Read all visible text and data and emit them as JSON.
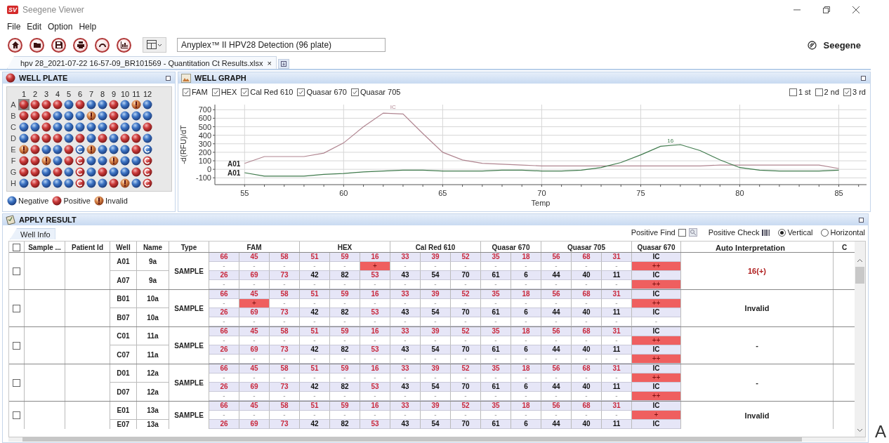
{
  "window": {
    "logo": "SV",
    "title": "Seegene Viewer",
    "controls": [
      {
        "kind": "minimize"
      },
      {
        "kind": "restore"
      },
      {
        "kind": "close"
      }
    ]
  },
  "menu": [
    "File",
    "Edit",
    "Option",
    "Help"
  ],
  "toolbar": {
    "buttons": [
      {
        "kind": "home"
      },
      {
        "kind": "open"
      },
      {
        "kind": "save"
      },
      {
        "kind": "print"
      },
      {
        "kind": "arch"
      },
      {
        "kind": "chart"
      }
    ],
    "layout_button": {
      "kind": "layout"
    },
    "assay": "Anyplex™ II HPV28 Detection (96 plate)",
    "brand": "Seegene"
  },
  "document_tabs": [
    {
      "label": "hpv 28_2021-07-22 16-57-09_BR101569 -  Quantitation Ct Results.xlsx",
      "close": "×",
      "selected": true
    }
  ],
  "well_plate": {
    "title": "WELL PLATE",
    "columns": [
      "1",
      "2",
      "3",
      "4",
      "5",
      "6",
      "7",
      "8",
      "9",
      "10",
      "11",
      "12"
    ],
    "rows": [
      {
        "label": "A",
        "wells": [
          {
            "kind": "positive",
            "selected": true
          },
          {
            "kind": "positive",
            "selected": false
          },
          {
            "kind": "positive",
            "selected": false
          },
          {
            "kind": "positive",
            "selected": false
          },
          {
            "kind": "negative",
            "selected": false
          },
          {
            "kind": "positive",
            "selected": false
          },
          {
            "kind": "negative",
            "selected": false
          },
          {
            "kind": "negative",
            "selected": false
          },
          {
            "kind": "positive",
            "selected": false
          },
          {
            "kind": "negative",
            "selected": false
          },
          {
            "kind": "invalid",
            "selected": false
          },
          {
            "kind": "negative",
            "selected": false
          }
        ]
      },
      {
        "label": "B",
        "wells": [
          {
            "kind": "positive",
            "selected": false
          },
          {
            "kind": "positive",
            "selected": false
          },
          {
            "kind": "positive",
            "selected": false
          },
          {
            "kind": "negative",
            "selected": false
          },
          {
            "kind": "negative",
            "selected": false
          },
          {
            "kind": "negative",
            "selected": false
          },
          {
            "kind": "invalid",
            "selected": false
          },
          {
            "kind": "negative",
            "selected": false
          },
          {
            "kind": "positive",
            "selected": false
          },
          {
            "kind": "negative",
            "selected": false
          },
          {
            "kind": "negative",
            "selected": false
          },
          {
            "kind": "negative",
            "selected": false
          }
        ]
      },
      {
        "label": "C",
        "wells": [
          {
            "kind": "negative",
            "selected": false
          },
          {
            "kind": "negative",
            "selected": false
          },
          {
            "kind": "positive",
            "selected": false
          },
          {
            "kind": "negative",
            "selected": false
          },
          {
            "kind": "negative",
            "selected": false
          },
          {
            "kind": "negative",
            "selected": false
          },
          {
            "kind": "negative",
            "selected": false
          },
          {
            "kind": "negative",
            "selected": false
          },
          {
            "kind": "positive",
            "selected": false
          },
          {
            "kind": "negative",
            "selected": false
          },
          {
            "kind": "negative",
            "selected": false
          },
          {
            "kind": "positive",
            "selected": false
          }
        ]
      },
      {
        "label": "D",
        "wells": [
          {
            "kind": "negative",
            "selected": false
          },
          {
            "kind": "positive",
            "selected": false
          },
          {
            "kind": "positive",
            "selected": false
          },
          {
            "kind": "positive",
            "selected": false
          },
          {
            "kind": "negative",
            "selected": false
          },
          {
            "kind": "positive",
            "selected": false
          },
          {
            "kind": "negative",
            "selected": false
          },
          {
            "kind": "positive",
            "selected": false
          },
          {
            "kind": "negative",
            "selected": false
          },
          {
            "kind": "positive",
            "selected": false
          },
          {
            "kind": "positive",
            "selected": false
          },
          {
            "kind": "negative",
            "selected": false
          }
        ]
      },
      {
        "label": "E",
        "wells": [
          {
            "kind": "invalid",
            "selected": false
          },
          {
            "kind": "positive",
            "selected": false
          },
          {
            "kind": "negative",
            "selected": false
          },
          {
            "kind": "negative",
            "selected": false
          },
          {
            "kind": "positive",
            "selected": false
          },
          {
            "kind": "control_negative",
            "selected": false
          },
          {
            "kind": "invalid",
            "selected": false
          },
          {
            "kind": "negative",
            "selected": false
          },
          {
            "kind": "negative",
            "selected": false
          },
          {
            "kind": "negative",
            "selected": false
          },
          {
            "kind": "positive",
            "selected": false
          },
          {
            "kind": "control_negative",
            "selected": false
          }
        ]
      },
      {
        "label": "F",
        "wells": [
          {
            "kind": "positive",
            "selected": false
          },
          {
            "kind": "positive",
            "selected": false
          },
          {
            "kind": "invalid",
            "selected": false
          },
          {
            "kind": "negative",
            "selected": false
          },
          {
            "kind": "positive",
            "selected": false
          },
          {
            "kind": "control_positive",
            "selected": false
          },
          {
            "kind": "negative",
            "selected": false
          },
          {
            "kind": "negative",
            "selected": false
          },
          {
            "kind": "invalid",
            "selected": false
          },
          {
            "kind": "negative",
            "selected": false
          },
          {
            "kind": "negative",
            "selected": false
          },
          {
            "kind": "control_positive",
            "selected": false
          }
        ]
      },
      {
        "label": "G",
        "wells": [
          {
            "kind": "positive",
            "selected": false
          },
          {
            "kind": "positive",
            "selected": false
          },
          {
            "kind": "negative",
            "selected": false
          },
          {
            "kind": "positive",
            "selected": false
          },
          {
            "kind": "negative",
            "selected": false
          },
          {
            "kind": "control_positive",
            "selected": false
          },
          {
            "kind": "negative",
            "selected": false
          },
          {
            "kind": "positive",
            "selected": false
          },
          {
            "kind": "negative",
            "selected": false
          },
          {
            "kind": "negative",
            "selected": false
          },
          {
            "kind": "positive",
            "selected": false
          },
          {
            "kind": "control_positive",
            "selected": false
          }
        ]
      },
      {
        "label": "H",
        "wells": [
          {
            "kind": "negative",
            "selected": false
          },
          {
            "kind": "positive",
            "selected": false
          },
          {
            "kind": "negative",
            "selected": false
          },
          {
            "kind": "negative",
            "selected": false
          },
          {
            "kind": "negative",
            "selected": false
          },
          {
            "kind": "control_positive",
            "selected": false
          },
          {
            "kind": "negative",
            "selected": false
          },
          {
            "kind": "negative",
            "selected": false
          },
          {
            "kind": "positive",
            "selected": false
          },
          {
            "kind": "invalid",
            "selected": false
          },
          {
            "kind": "negative",
            "selected": false
          },
          {
            "kind": "control_positive",
            "selected": false
          }
        ]
      }
    ],
    "legend": [
      {
        "kind": "negative",
        "label": "Negative"
      },
      {
        "kind": "positive",
        "label": "Positive"
      },
      {
        "kind": "invalid",
        "label": "Invalid"
      }
    ]
  },
  "well_graph": {
    "title": "WELL GRAPH",
    "channels": [
      {
        "label": "FAM",
        "checked": true
      },
      {
        "label": "HEX",
        "checked": true
      },
      {
        "label": "Cal Red 610",
        "checked": true
      },
      {
        "label": "Quasar 670",
        "checked": true
      },
      {
        "label": "Quasar 705",
        "checked": true
      }
    ],
    "melts": [
      {
        "label": "1 st",
        "checked": false
      },
      {
        "label": "2 nd",
        "checked": false
      },
      {
        "label": "3 rd",
        "checked": true
      }
    ],
    "chart_data": {
      "type": "line",
      "xlabel": "Temp",
      "ylabel": "-d(RFU)/dT",
      "x": [
        55,
        56,
        57,
        58,
        59,
        60,
        61,
        62,
        63,
        64,
        65,
        66,
        67,
        68,
        69,
        70,
        71,
        72,
        73,
        74,
        75,
        76,
        77,
        78,
        79,
        80,
        81,
        82,
        83,
        84,
        85
      ],
      "series": [
        {
          "name": "A01",
          "color": "#b08590",
          "values": [
            70,
            150,
            150,
            150,
            190,
            310,
            500,
            660,
            650,
            420,
            200,
            110,
            70,
            60,
            50,
            40,
            40,
            40,
            40,
            40,
            40,
            40,
            40,
            40,
            50,
            50,
            50,
            50,
            50,
            50,
            10
          ]
        },
        {
          "name": "A01",
          "color": "#3f7a4c",
          "values": [
            -40,
            -80,
            -80,
            -80,
            -60,
            -50,
            -30,
            -20,
            -10,
            -10,
            -20,
            -20,
            -20,
            -10,
            -10,
            -20,
            -20,
            -10,
            20,
            80,
            170,
            270,
            290,
            220,
            110,
            20,
            -10,
            -20,
            -20,
            -20,
            -10
          ]
        }
      ],
      "xlim": [
        53.5,
        86.4
      ],
      "ylim": [
        -180,
        760
      ],
      "xticks": [
        55,
        60,
        65,
        70,
        75,
        80,
        85
      ],
      "yticks": [
        -100,
        0,
        100,
        200,
        300,
        400,
        500,
        600,
        700
      ],
      "grid": true,
      "annotations": [
        {
          "x": 62.5,
          "y": 690,
          "text": "IC"
        },
        {
          "x": 76.5,
          "y": 300,
          "text": "16"
        }
      ]
    }
  },
  "apply_result": {
    "title": "APPLY RESULT",
    "tabs": [
      {
        "label": "Well Info",
        "selected": true
      }
    ],
    "positive_find": {
      "label": "Positive Find",
      "checked": false
    },
    "positive_check": {
      "label": "Positive Check"
    },
    "orientation": [
      {
        "label": "Vertical",
        "selected": true
      },
      {
        "label": "Horizontal",
        "selected": false
      }
    ],
    "columns": {
      "check_all": false,
      "sample": "Sample ...",
      "patient": "Patient Id",
      "well": "Well",
      "name": "Name",
      "type": "Type",
      "channels": [
        "FAM",
        "HEX",
        "Cal Red 610",
        "Quasar 670",
        "Quasar 705",
        "Quasar 670"
      ],
      "interpretation": "Auto  Interpretation",
      "column_14": "C"
    },
    "groups": [
      {
        "checked": false,
        "type": "SAMPLE",
        "interpretation": "16(+)",
        "interpretation_positive": true,
        "wells": [
          {
            "well": "A01",
            "name": "9a",
            "types": [
              [
                "66",
                "45",
                "58"
              ],
              [
                "51",
                "59",
                "16"
              ],
              [
                "33",
                "39",
                "52"
              ],
              [
                "35",
                "18"
              ],
              [
                "56",
                "68",
                "31"
              ],
              [
                "IC"
              ]
            ],
            "high_risk": [
              [
                true,
                true,
                true
              ],
              [
                true,
                true,
                true
              ],
              [
                true,
                true,
                true
              ],
              [
                true,
                true
              ],
              [
                true,
                true,
                true
              ],
              [
                false
              ]
            ],
            "results": [
              [
                "-",
                "-",
                "-"
              ],
              [
                "-",
                "-",
                "+"
              ],
              [
                "-",
                "-",
                "-"
              ],
              [
                "-",
                "-"
              ],
              [
                "-",
                "-",
                "-"
              ],
              [
                "++"
              ]
            ],
            "hits": [
              [
                false,
                false,
                false
              ],
              [
                false,
                false,
                true
              ],
              [
                false,
                false,
                false
              ],
              [
                false,
                false
              ],
              [
                false,
                false,
                false
              ],
              [
                true
              ]
            ]
          },
          {
            "well": "A07",
            "name": "9a",
            "types": [
              [
                "26",
                "69",
                "73"
              ],
              [
                "42",
                "82",
                "53"
              ],
              [
                "43",
                "54",
                "70"
              ],
              [
                "61",
                "6"
              ],
              [
                "44",
                "40",
                "11"
              ],
              [
                "IC"
              ]
            ],
            "high_risk": [
              [
                true,
                true,
                true
              ],
              [
                false,
                false,
                true
              ],
              [
                false,
                false,
                false
              ],
              [
                false,
                false
              ],
              [
                false,
                false,
                false
              ],
              [
                false
              ]
            ],
            "results": [
              [
                "-",
                "-",
                "-"
              ],
              [
                "-",
                "-",
                "-"
              ],
              [
                "-",
                "-",
                "-"
              ],
              [
                "-",
                "-"
              ],
              [
                "-",
                "-",
                "-"
              ],
              [
                "++"
              ]
            ],
            "hits": [
              [
                false,
                false,
                false
              ],
              [
                false,
                false,
                false
              ],
              [
                false,
                false,
                false
              ],
              [
                false,
                false
              ],
              [
                false,
                false,
                false
              ],
              [
                true
              ]
            ]
          }
        ]
      },
      {
        "checked": false,
        "type": "SAMPLE",
        "interpretation": "Invalid",
        "interpretation_positive": false,
        "wells": [
          {
            "well": "B01",
            "name": "10a",
            "types": [
              [
                "66",
                "45",
                "58"
              ],
              [
                "51",
                "59",
                "16"
              ],
              [
                "33",
                "39",
                "52"
              ],
              [
                "35",
                "18"
              ],
              [
                "56",
                "68",
                "31"
              ],
              [
                "IC"
              ]
            ],
            "high_risk": [
              [
                true,
                true,
                true
              ],
              [
                true,
                true,
                true
              ],
              [
                true,
                true,
                true
              ],
              [
                true,
                true
              ],
              [
                true,
                true,
                true
              ],
              [
                false
              ]
            ],
            "results": [
              [
                "-",
                "+",
                "-"
              ],
              [
                "-",
                "-",
                "-"
              ],
              [
                "-",
                "-",
                "-"
              ],
              [
                "-",
                "-"
              ],
              [
                "-",
                "-",
                "-"
              ],
              [
                "++"
              ]
            ],
            "hits": [
              [
                false,
                true,
                false
              ],
              [
                false,
                false,
                false
              ],
              [
                false,
                false,
                false
              ],
              [
                false,
                false
              ],
              [
                false,
                false,
                false
              ],
              [
                true
              ]
            ]
          },
          {
            "well": "B07",
            "name": "10a",
            "types": [
              [
                "26",
                "69",
                "73"
              ],
              [
                "42",
                "82",
                "53"
              ],
              [
                "43",
                "54",
                "70"
              ],
              [
                "61",
                "6"
              ],
              [
                "44",
                "40",
                "11"
              ],
              [
                "IC"
              ]
            ],
            "high_risk": [
              [
                true,
                true,
                true
              ],
              [
                false,
                false,
                true
              ],
              [
                false,
                false,
                false
              ],
              [
                false,
                false
              ],
              [
                false,
                false,
                false
              ],
              [
                false
              ]
            ],
            "results": [
              [
                "-",
                "-",
                "-"
              ],
              [
                "-",
                "-",
                "-"
              ],
              [
                "-",
                "-",
                "-"
              ],
              [
                "-",
                "-"
              ],
              [
                "-",
                "-",
                "-"
              ],
              [
                "-"
              ]
            ],
            "hits": [
              [
                false,
                false,
                false
              ],
              [
                false,
                false,
                false
              ],
              [
                false,
                false,
                false
              ],
              [
                false,
                false
              ],
              [
                false,
                false,
                false
              ],
              [
                false
              ]
            ]
          }
        ]
      },
      {
        "checked": false,
        "type": "SAMPLE",
        "interpretation": "-",
        "interpretation_positive": false,
        "wells": [
          {
            "well": "C01",
            "name": "11a",
            "types": [
              [
                "66",
                "45",
                "58"
              ],
              [
                "51",
                "59",
                "16"
              ],
              [
                "33",
                "39",
                "52"
              ],
              [
                "35",
                "18"
              ],
              [
                "56",
                "68",
                "31"
              ],
              [
                "IC"
              ]
            ],
            "high_risk": [
              [
                true,
                true,
                true
              ],
              [
                true,
                true,
                true
              ],
              [
                true,
                true,
                true
              ],
              [
                true,
                true
              ],
              [
                true,
                true,
                true
              ],
              [
                false
              ]
            ],
            "results": [
              [
                "-",
                "-",
                "-"
              ],
              [
                "-",
                "-",
                "-"
              ],
              [
                "-",
                "-",
                "-"
              ],
              [
                "-",
                "-"
              ],
              [
                "-",
                "-",
                "-"
              ],
              [
                "++"
              ]
            ],
            "hits": [
              [
                false,
                false,
                false
              ],
              [
                false,
                false,
                false
              ],
              [
                false,
                false,
                false
              ],
              [
                false,
                false
              ],
              [
                false,
                false,
                false
              ],
              [
                true
              ]
            ]
          },
          {
            "well": "C07",
            "name": "11a",
            "types": [
              [
                "26",
                "69",
                "73"
              ],
              [
                "42",
                "82",
                "53"
              ],
              [
                "43",
                "54",
                "70"
              ],
              [
                "61",
                "6"
              ],
              [
                "44",
                "40",
                "11"
              ],
              [
                "IC"
              ]
            ],
            "high_risk": [
              [
                true,
                true,
                true
              ],
              [
                false,
                false,
                true
              ],
              [
                false,
                false,
                false
              ],
              [
                false,
                false
              ],
              [
                false,
                false,
                false
              ],
              [
                false
              ]
            ],
            "results": [
              [
                "-",
                "-",
                "-"
              ],
              [
                "-",
                "-",
                "-"
              ],
              [
                "-",
                "-",
                "-"
              ],
              [
                "-",
                "-"
              ],
              [
                "-",
                "-",
                "-"
              ],
              [
                "++"
              ]
            ],
            "hits": [
              [
                false,
                false,
                false
              ],
              [
                false,
                false,
                false
              ],
              [
                false,
                false,
                false
              ],
              [
                false,
                false
              ],
              [
                false,
                false,
                false
              ],
              [
                true
              ]
            ]
          }
        ]
      },
      {
        "checked": false,
        "type": "SAMPLE",
        "interpretation": "-",
        "interpretation_positive": false,
        "wells": [
          {
            "well": "D01",
            "name": "12a",
            "types": [
              [
                "66",
                "45",
                "58"
              ],
              [
                "51",
                "59",
                "16"
              ],
              [
                "33",
                "39",
                "52"
              ],
              [
                "35",
                "18"
              ],
              [
                "56",
                "68",
                "31"
              ],
              [
                "IC"
              ]
            ],
            "high_risk": [
              [
                true,
                true,
                true
              ],
              [
                true,
                true,
                true
              ],
              [
                true,
                true,
                true
              ],
              [
                true,
                true
              ],
              [
                true,
                true,
                true
              ],
              [
                false
              ]
            ],
            "results": [
              [
                "-",
                "-",
                "-"
              ],
              [
                "-",
                "-",
                "-"
              ],
              [
                "-",
                "-",
                "-"
              ],
              [
                "-",
                "-"
              ],
              [
                "-",
                "-",
                "-"
              ],
              [
                "++"
              ]
            ],
            "hits": [
              [
                false,
                false,
                false
              ],
              [
                false,
                false,
                false
              ],
              [
                false,
                false,
                false
              ],
              [
                false,
                false
              ],
              [
                false,
                false,
                false
              ],
              [
                true
              ]
            ]
          },
          {
            "well": "D07",
            "name": "12a",
            "types": [
              [
                "26",
                "69",
                "73"
              ],
              [
                "42",
                "82",
                "53"
              ],
              [
                "43",
                "54",
                "70"
              ],
              [
                "61",
                "6"
              ],
              [
                "44",
                "40",
                "11"
              ],
              [
                "IC"
              ]
            ],
            "high_risk": [
              [
                true,
                true,
                true
              ],
              [
                false,
                false,
                true
              ],
              [
                false,
                false,
                false
              ],
              [
                false,
                false
              ],
              [
                false,
                false,
                false
              ],
              [
                false
              ]
            ],
            "results": [
              [
                "-",
                "-",
                "-"
              ],
              [
                "-",
                "-",
                "-"
              ],
              [
                "-",
                "-",
                "-"
              ],
              [
                "-",
                "-"
              ],
              [
                "-",
                "-",
                "-"
              ],
              [
                "++"
              ]
            ],
            "hits": [
              [
                false,
                false,
                false
              ],
              [
                false,
                false,
                false
              ],
              [
                false,
                false,
                false
              ],
              [
                false,
                false
              ],
              [
                false,
                false,
                false
              ],
              [
                true
              ]
            ]
          }
        ]
      },
      {
        "checked": false,
        "type": "SAMPLE",
        "interpretation": "Invalid",
        "interpretation_positive": false,
        "wells": [
          {
            "well": "E01",
            "name": "13a",
            "types": [
              [
                "66",
                "45",
                "58"
              ],
              [
                "51",
                "59",
                "16"
              ],
              [
                "33",
                "39",
                "52"
              ],
              [
                "35",
                "18"
              ],
              [
                "56",
                "68",
                "31"
              ],
              [
                "IC"
              ]
            ],
            "high_risk": [
              [
                true,
                true,
                true
              ],
              [
                true,
                true,
                true
              ],
              [
                true,
                true,
                true
              ],
              [
                true,
                true
              ],
              [
                true,
                true,
                true
              ],
              [
                false
              ]
            ],
            "results": [
              [
                "-",
                "-",
                "-"
              ],
              [
                "-",
                "-",
                "-"
              ],
              [
                "-",
                "-",
                "-"
              ],
              [
                "-",
                "-"
              ],
              [
                "-",
                "-",
                "-"
              ],
              [
                "+"
              ]
            ],
            "hits": [
              [
                false,
                false,
                false
              ],
              [
                false,
                false,
                false
              ],
              [
                false,
                false,
                false
              ],
              [
                false,
                false
              ],
              [
                false,
                false,
                false
              ],
              [
                true
              ]
            ]
          },
          {
            "well": "E07",
            "name": "13a",
            "types": [
              [
                "26",
                "69",
                "73"
              ],
              [
                "42",
                "82",
                "53"
              ],
              [
                "43",
                "54",
                "70"
              ],
              [
                "61",
                "6"
              ],
              [
                "44",
                "40",
                "11"
              ],
              [
                "IC"
              ]
            ],
            "high_risk": [
              [
                true,
                true,
                true
              ],
              [
                false,
                false,
                true
              ],
              [
                false,
                false,
                false
              ],
              [
                false,
                false
              ],
              [
                false,
                false,
                false
              ],
              [
                false
              ]
            ]
          }
        ]
      }
    ]
  },
  "stray_text": "A"
}
